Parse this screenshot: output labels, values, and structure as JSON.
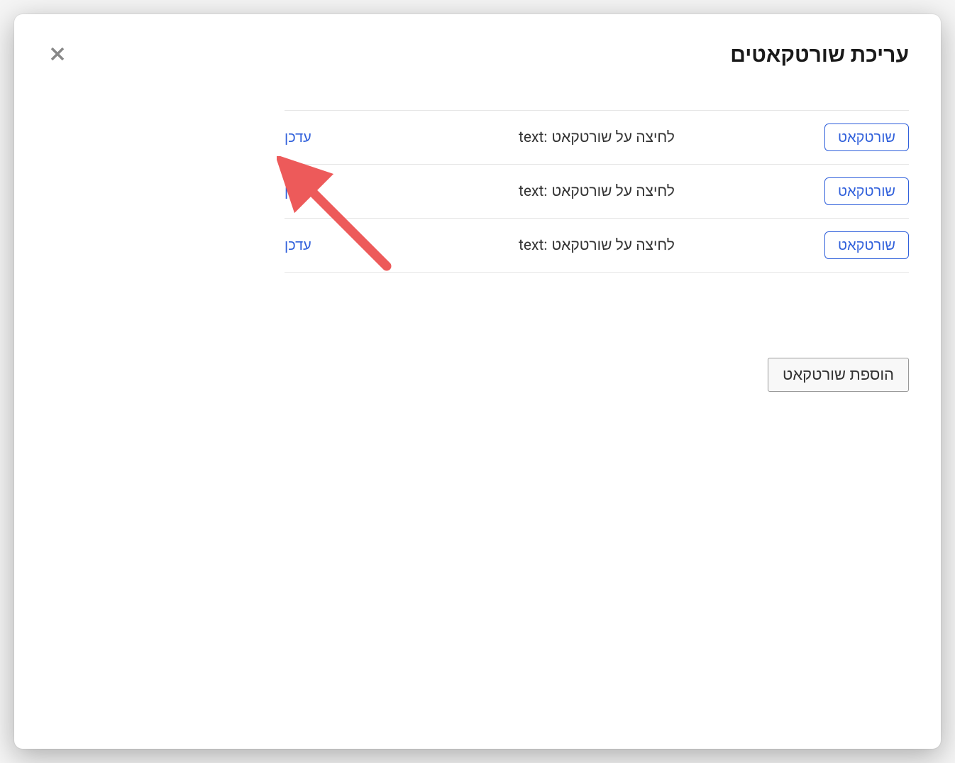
{
  "modal": {
    "title": "עריכת שורטקאטים",
    "shortcuts": [
      {
        "badge": "שורטקאט",
        "text_prefix": "text:",
        "text": "לחיצה על שורטקאט",
        "update_label": "עדכן"
      },
      {
        "badge": "שורטקאט",
        "text_prefix": "text:",
        "text": "לחיצה על שורטקאט",
        "update_label": "עדכן"
      },
      {
        "badge": "שורטקאט",
        "text_prefix": "text:",
        "text": "לחיצה על שורטקאט",
        "update_label": "עדכן"
      }
    ],
    "add_button_label": "הוספת שורטקאט"
  },
  "colors": {
    "accent": "#3060db",
    "annotation": "#ed5a5a"
  }
}
